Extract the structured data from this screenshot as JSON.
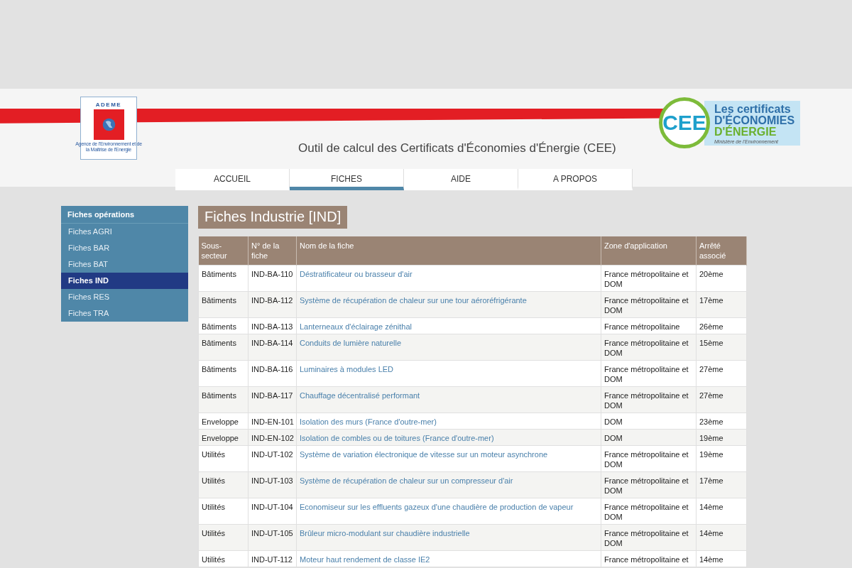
{
  "header": {
    "ademe_logo": {
      "name": "ADEME",
      "caption": "Agence de l'Environnement et de la Maîtrise de l'Energie"
    },
    "title": "Outil de calcul des Certificats d'Économies d'Énergie (CEE)",
    "cee_logo": {
      "badge": "CEE",
      "line_1": "Les certificats",
      "line_2": "D'ÉCONOMIES",
      "line_3": "D'ÉNERGIE",
      "ministry": "Ministère de l'Environnement"
    }
  },
  "nav": [
    {
      "label": "ACCUEIL",
      "selected": false
    },
    {
      "label": "FICHES",
      "selected": true
    },
    {
      "label": "AIDE",
      "selected": false
    },
    {
      "label": "A PROPOS",
      "selected": false
    }
  ],
  "sidebar": {
    "title": "Fiches opérations",
    "items": [
      {
        "label": "Fiches AGRI",
        "selected": false
      },
      {
        "label": "Fiches BAR",
        "selected": false
      },
      {
        "label": "Fiches BAT",
        "selected": false
      },
      {
        "label": "Fiches IND",
        "selected": true
      },
      {
        "label": "Fiches RES",
        "selected": false
      },
      {
        "label": "Fiches TRA",
        "selected": false
      }
    ]
  },
  "page_title": "Fiches Industrie [IND]",
  "table": {
    "columns": [
      "Sous-secteur",
      "N° de la fiche",
      "Nom de la fiche",
      "Zone d'application",
      "Arrêté associé"
    ],
    "rows": [
      [
        "Bâtiments",
        "IND-BA-110",
        "Déstratificateur ou brasseur d'air",
        "France métropolitaine et DOM",
        "20ème"
      ],
      [
        "Bâtiments",
        "IND-BA-112",
        "Système de récupération de chaleur sur une tour aéroréfrigérante",
        "France métropolitaine et DOM",
        "17ème"
      ],
      [
        "Bâtiments",
        "IND-BA-113",
        "Lanterneaux d'éclairage zénithal",
        "France métropolitaine",
        "26ème"
      ],
      [
        "Bâtiments",
        "IND-BA-114",
        "Conduits de lumière naturelle",
        "France métropolitaine et DOM",
        "15ème"
      ],
      [
        "Bâtiments",
        "IND-BA-116",
        "Luminaires à modules LED",
        "France métropolitaine et DOM",
        "27ème"
      ],
      [
        "Bâtiments",
        "IND-BA-117",
        "Chauffage décentralisé performant",
        "France métropolitaine et DOM",
        "27ème"
      ],
      [
        "Enveloppe",
        "IND-EN-101",
        "Isolation des murs (France d'outre-mer)",
        "DOM",
        "23ème"
      ],
      [
        "Enveloppe",
        "IND-EN-102",
        "Isolation de combles ou de toitures (France d'outre-mer)",
        "DOM",
        "19ème"
      ],
      [
        "Utilités",
        "IND-UT-102",
        "Système de variation électronique de vitesse sur un moteur asynchrone",
        "France métropolitaine et DOM",
        "19ème"
      ],
      [
        "Utilités",
        "IND-UT-103",
        "Système de récupération de chaleur sur un compresseur d'air",
        "France métropolitaine et DOM",
        "17ème"
      ],
      [
        "Utilités",
        "IND-UT-104",
        "Economiseur sur les effluents gazeux d'une chaudière de production de vapeur",
        "France métropolitaine et DOM",
        "14ème"
      ],
      [
        "Utilités",
        "IND-UT-105",
        "Brûleur micro-modulant sur chaudière industrielle",
        "France métropolitaine et DOM",
        "14ème"
      ],
      [
        "Utilités",
        "IND-UT-112",
        "Moteur haut rendement de classe IE2",
        "France métropolitaine et",
        "14ème"
      ]
    ]
  }
}
